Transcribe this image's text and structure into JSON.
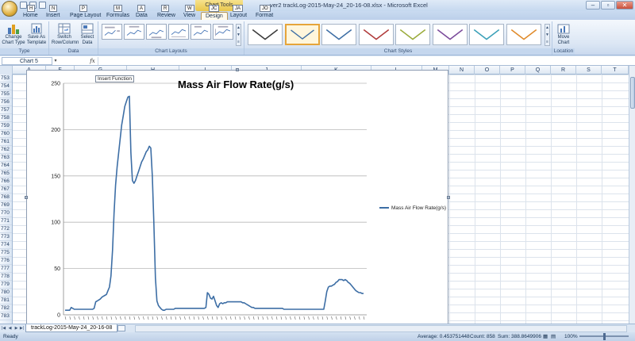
{
  "titlebar": {
    "window_title": "ver2 trackLog-2015-May-24_20-16-08.xlsx - Microsoft Excel",
    "contextual_tab": "Chart Tools",
    "minimize": "–",
    "restore": "▫",
    "close": "✕"
  },
  "keytips": [
    "H",
    "N",
    "P",
    "M",
    "A",
    "R",
    "W",
    "JC",
    "JA",
    "JO"
  ],
  "tabs": [
    {
      "label": "Home"
    },
    {
      "label": "Insert"
    },
    {
      "label": "Page Layout"
    },
    {
      "label": "Formulas"
    },
    {
      "label": "Data"
    },
    {
      "label": "Review"
    },
    {
      "label": "View"
    },
    {
      "label": "Design",
      "active": true
    },
    {
      "label": "Layout"
    },
    {
      "label": "Format"
    }
  ],
  "ribbon": {
    "type_group": {
      "label": "Type",
      "change_chart_type": [
        "Change",
        "Chart Type"
      ],
      "save_as_template": [
        "Save As",
        "Template"
      ]
    },
    "data_group": {
      "label": "Data",
      "switch_row_column": [
        "Switch",
        "Row/Column"
      ],
      "select_data": [
        "Select",
        "Data"
      ]
    },
    "layouts_group": {
      "label": "Chart Layouts"
    },
    "styles_group": {
      "label": "Chart Styles",
      "style_colors": [
        "#3a3a3a",
        "#3d6ea5",
        "#3d6ea5",
        "#b03a3a",
        "#9aab3a",
        "#7a4a9a",
        "#3aa0b8",
        "#e08a2a"
      ]
    },
    "location_group": {
      "label": "Location",
      "move_chart": [
        "Move",
        "Chart"
      ]
    }
  },
  "formula_bar": {
    "name_box": "Chart 5",
    "fx": "fx",
    "tooltip": "Insert Function",
    "formula": ""
  },
  "columns": [
    "A",
    "F",
    "G",
    "H",
    "I",
    "J",
    "K",
    "L",
    "M",
    "N",
    "O",
    "P",
    "Q",
    "R",
    "S",
    "T"
  ],
  "rows": [
    "753",
    "754",
    "755",
    "756",
    "757",
    "758",
    "759",
    "760",
    "761",
    "762",
    "763",
    "764",
    "765",
    "766",
    "767",
    "768",
    "769",
    "770",
    "771",
    "772",
    "773",
    "774",
    "775",
    "776",
    "777",
    "778",
    "779",
    "780",
    "781",
    "782",
    "783"
  ],
  "chart_data": {
    "type": "line",
    "title": "Mass Air Flow Rate(g/s)",
    "ylim": [
      0,
      250
    ],
    "yticks": [
      0,
      50,
      100,
      150,
      200,
      250
    ],
    "legend_position": "right",
    "series": [
      {
        "name": "Mass Air Flow Rate(g/s)",
        "color": "#3d6ea5",
        "values": [
          5,
          5,
          5,
          5,
          8,
          7,
          6,
          6,
          6,
          6,
          6,
          6,
          6,
          6,
          6,
          6,
          6,
          6,
          6,
          7,
          14,
          15,
          16,
          17,
          19,
          20,
          21,
          22,
          26,
          30,
          42,
          70,
          110,
          140,
          160,
          175,
          190,
          205,
          215,
          225,
          230,
          235,
          236,
          175,
          145,
          142,
          145,
          150,
          155,
          160,
          165,
          168,
          172,
          176,
          178,
          182,
          180,
          150,
          100,
          40,
          15,
          10,
          8,
          6,
          5,
          5,
          6,
          6,
          6,
          6,
          6,
          6,
          7,
          7,
          7,
          7,
          7,
          7,
          7,
          7,
          7,
          7,
          7,
          7,
          7,
          7,
          7,
          7,
          7,
          7,
          7,
          7,
          8,
          24,
          22,
          18,
          17,
          20,
          15,
          10,
          8,
          12,
          13,
          12,
          13,
          13,
          14,
          14,
          14,
          14,
          14,
          14,
          14,
          14,
          14,
          14,
          13,
          13,
          12,
          11,
          10,
          9,
          8,
          8,
          7,
          7,
          7,
          7,
          7,
          7,
          7,
          7,
          7,
          7,
          7,
          7,
          7,
          7,
          7,
          7,
          7,
          7,
          7,
          6,
          6,
          6,
          6,
          6,
          6,
          6,
          6,
          6,
          6,
          6,
          6,
          6,
          6,
          6,
          6,
          6,
          6,
          6,
          6,
          6,
          6,
          6,
          6,
          6,
          6,
          6,
          15,
          25,
          30,
          31,
          31,
          32,
          33,
          35,
          36,
          38,
          38,
          38,
          37,
          38,
          37,
          35,
          34,
          32,
          30,
          28,
          26,
          25,
          24,
          24,
          23,
          23
        ]
      }
    ]
  },
  "sheet_tab": "trackLog-2015-May-24_20-16-08",
  "statusbar": {
    "ready": "Ready",
    "average": "Average: 0.453751448",
    "count": "Count: 858",
    "sum": "Sum: 388.8649906",
    "zoom": "100%"
  }
}
